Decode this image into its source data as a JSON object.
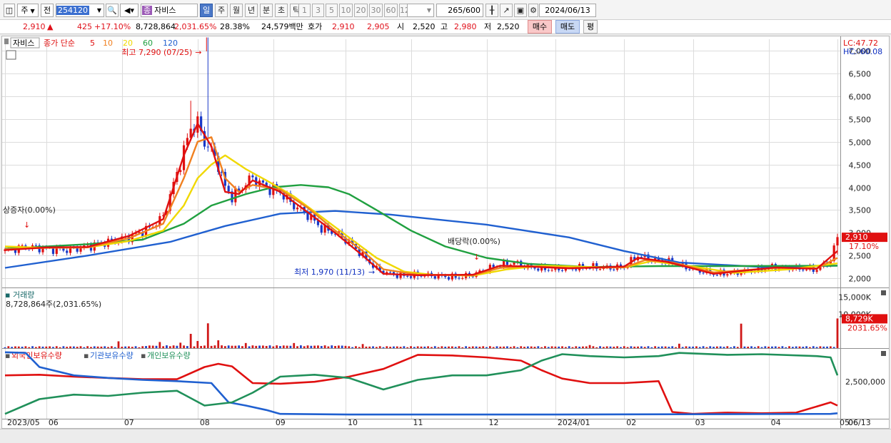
{
  "toolbar": {
    "market_select": "주",
    "prev_label": "전",
    "code": "254120",
    "name_badge": "종",
    "stock_name": "자비스",
    "period_buttons": [
      "일",
      "주",
      "월",
      "년",
      "분",
      "초",
      "틱"
    ],
    "active_period": "일",
    "interval_buttons": [
      "1",
      "3",
      "5",
      "10",
      "20",
      "30",
      "60",
      "120"
    ],
    "count": "265",
    "count_total": "/600",
    "date": "2024/06/13"
  },
  "quote": {
    "price": "2,910",
    "arrow": "▲",
    "change": "425",
    "change_pct": "+17.10%",
    "volume": "8,728,864",
    "volume_ratio": "2,031.65%",
    "turnover": "28.38%",
    "amount": "24,579백만",
    "hoga_label": "호가",
    "ask": "2,910",
    "bid": "2,905",
    "open_label": "시",
    "open": "2,520",
    "high_label": "고",
    "high": "2,980",
    "low_label": "저",
    "low": "2,520",
    "buy_button": "매수",
    "sell_button": "매도",
    "eval_button": "평"
  },
  "price_panel": {
    "legend_name": "자비스",
    "legend_ma_label": "종가 단순",
    "ma_periods": [
      "5",
      "10",
      "20",
      "60",
      "120"
    ],
    "ma_colors": [
      "#e01010",
      "#f08020",
      "#f0d800",
      "#20a040",
      "#2060d0"
    ],
    "lc": "LC:47.72",
    "hc": "HC:-60.08",
    "last_price": "2,910",
    "last_pct": "17.10%",
    "annotations": {
      "high": "최고 7,290 (07/25)",
      "low": "최저 1,970 (11/13)",
      "rights": "상증자(0.00%)",
      "dividend": "배당락(0.00%)"
    }
  },
  "volume_panel": {
    "title": "거래량",
    "value": "8,728,864주(2,031.65%)",
    "last_value": "8,729K",
    "last_pct": "2031.65%"
  },
  "holding_panel": {
    "series_labels": [
      "외국인보유수량",
      "기관보유수량",
      "개인보유수량"
    ],
    "series_colors": [
      "#e01010",
      "#2060d0",
      "#20905a"
    ]
  },
  "chart_data": [
    {
      "type": "candlestick",
      "title": "자비스",
      "x": [
        "2023/05",
        "06",
        "07",
        "08",
        "09",
        "10",
        "11",
        "12",
        "2024/01",
        "02",
        "03",
        "04",
        "05",
        "06"
      ],
      "y_ticks": [
        2000,
        2500,
        3000,
        3500,
        4000,
        4500,
        5000,
        5500,
        6000,
        6500,
        7000
      ],
      "ylim": [
        1800,
        7250
      ],
      "close_path": [
        [
          0,
          2600
        ],
        [
          6,
          2700
        ],
        [
          12,
          2650
        ],
        [
          18,
          2620
        ],
        [
          24,
          2700
        ],
        [
          30,
          2800
        ],
        [
          36,
          2900
        ],
        [
          42,
          3100
        ],
        [
          46,
          3350
        ],
        [
          50,
          4300
        ],
        [
          54,
          5300
        ],
        [
          56,
          5400
        ],
        [
          58,
          5000
        ],
        [
          60,
          4800
        ],
        [
          62,
          4500
        ],
        [
          64,
          4000
        ],
        [
          66,
          3800
        ],
        [
          68,
          3900
        ],
        [
          70,
          4100
        ],
        [
          72,
          4200
        ],
        [
          76,
          4000
        ],
        [
          80,
          3900
        ],
        [
          84,
          3600
        ],
        [
          88,
          3400
        ],
        [
          92,
          3100
        ],
        [
          96,
          3000
        ],
        [
          100,
          2800
        ],
        [
          104,
          2500
        ],
        [
          108,
          2200
        ],
        [
          112,
          2100
        ],
        [
          116,
          2050
        ],
        [
          120,
          2080
        ],
        [
          126,
          2050
        ],
        [
          132,
          2020
        ],
        [
          136,
          2080
        ],
        [
          140,
          2200
        ],
        [
          144,
          2300
        ],
        [
          148,
          2350
        ],
        [
          152,
          2250
        ],
        [
          158,
          2200
        ],
        [
          164,
          2220
        ],
        [
          170,
          2250
        ],
        [
          176,
          2230
        ],
        [
          180,
          2250
        ],
        [
          184,
          2500
        ],
        [
          188,
          2400
        ],
        [
          194,
          2350
        ],
        [
          200,
          2200
        ],
        [
          206,
          2100
        ],
        [
          212,
          2120
        ],
        [
          218,
          2180
        ],
        [
          224,
          2250
        ],
        [
          230,
          2220
        ],
        [
          236,
          2200
        ],
        [
          240,
          2400
        ],
        [
          242,
          2910
        ]
      ],
      "ma5_path": [
        [
          0,
          2620
        ],
        [
          12,
          2680
        ],
        [
          24,
          2690
        ],
        [
          36,
          2930
        ],
        [
          46,
          3300
        ],
        [
          52,
          4700
        ],
        [
          56,
          5400
        ],
        [
          60,
          4900
        ],
        [
          64,
          3900
        ],
        [
          68,
          3850
        ],
        [
          72,
          4150
        ],
        [
          80,
          3900
        ],
        [
          88,
          3450
        ],
        [
          96,
          3000
        ],
        [
          104,
          2500
        ],
        [
          110,
          2100
        ],
        [
          120,
          2070
        ],
        [
          136,
          2080
        ],
        [
          144,
          2280
        ],
        [
          152,
          2260
        ],
        [
          164,
          2220
        ],
        [
          180,
          2260
        ],
        [
          184,
          2450
        ],
        [
          192,
          2370
        ],
        [
          206,
          2100
        ],
        [
          224,
          2240
        ],
        [
          236,
          2210
        ],
        [
          242,
          2600
        ]
      ],
      "ma10_path": [
        [
          0,
          2640
        ],
        [
          12,
          2670
        ],
        [
          24,
          2680
        ],
        [
          36,
          2880
        ],
        [
          46,
          3200
        ],
        [
          52,
          4200
        ],
        [
          56,
          5000
        ],
        [
          60,
          5100
        ],
        [
          64,
          4200
        ],
        [
          68,
          3900
        ],
        [
          72,
          4050
        ],
        [
          80,
          3950
        ],
        [
          88,
          3550
        ],
        [
          96,
          3050
        ],
        [
          104,
          2600
        ],
        [
          110,
          2200
        ],
        [
          120,
          2080
        ],
        [
          136,
          2070
        ],
        [
          144,
          2230
        ],
        [
          152,
          2270
        ],
        [
          164,
          2230
        ],
        [
          180,
          2240
        ],
        [
          186,
          2400
        ],
        [
          194,
          2350
        ],
        [
          206,
          2130
        ],
        [
          224,
          2230
        ],
        [
          236,
          2220
        ],
        [
          242,
          2450
        ]
      ],
      "ma20_path": [
        [
          0,
          2700
        ],
        [
          12,
          2670
        ],
        [
          24,
          2680
        ],
        [
          36,
          2820
        ],
        [
          46,
          3050
        ],
        [
          52,
          3600
        ],
        [
          56,
          4200
        ],
        [
          60,
          4500
        ],
        [
          64,
          4700
        ],
        [
          70,
          4400
        ],
        [
          76,
          4150
        ],
        [
          84,
          3800
        ],
        [
          92,
          3350
        ],
        [
          100,
          2900
        ],
        [
          108,
          2450
        ],
        [
          116,
          2150
        ],
        [
          124,
          2080
        ],
        [
          136,
          2060
        ],
        [
          146,
          2200
        ],
        [
          156,
          2280
        ],
        [
          170,
          2250
        ],
        [
          180,
          2240
        ],
        [
          188,
          2380
        ],
        [
          200,
          2260
        ],
        [
          212,
          2120
        ],
        [
          228,
          2200
        ],
        [
          242,
          2330
        ]
      ],
      "ma60_path": [
        [
          0,
          2650
        ],
        [
          24,
          2750
        ],
        [
          40,
          2850
        ],
        [
          52,
          3200
        ],
        [
          60,
          3600
        ],
        [
          70,
          3850
        ],
        [
          78,
          4000
        ],
        [
          86,
          4050
        ],
        [
          94,
          4000
        ],
        [
          100,
          3850
        ],
        [
          108,
          3500
        ],
        [
          118,
          3050
        ],
        [
          128,
          2700
        ],
        [
          140,
          2450
        ],
        [
          152,
          2320
        ],
        [
          170,
          2250
        ],
        [
          190,
          2270
        ],
        [
          210,
          2270
        ],
        [
          242,
          2280
        ]
      ],
      "ma120_path": [
        [
          0,
          2230
        ],
        [
          24,
          2500
        ],
        [
          48,
          2800
        ],
        [
          64,
          3150
        ],
        [
          80,
          3420
        ],
        [
          96,
          3480
        ],
        [
          112,
          3400
        ],
        [
          140,
          3180
        ],
        [
          164,
          2900
        ],
        [
          180,
          2600
        ],
        [
          196,
          2350
        ],
        [
          220,
          2250
        ],
        [
          242,
          2280
        ]
      ]
    },
    {
      "type": "bar",
      "title": "거래량",
      "y_ticks": [
        "10,000K",
        "15,000K"
      ],
      "spikes": [
        [
          33,
          2000
        ],
        [
          45,
          1800
        ],
        [
          51,
          1600
        ],
        [
          54,
          4200
        ],
        [
          56,
          2100
        ],
        [
          59,
          7300
        ],
        [
          62,
          2300
        ],
        [
          70,
          1500
        ],
        [
          84,
          1500
        ],
        [
          104,
          1200
        ],
        [
          170,
          900
        ],
        [
          196,
          1300
        ],
        [
          214,
          7200
        ],
        [
          242,
          8729
        ]
      ]
    },
    {
      "type": "line",
      "title": "외국인보유수량 · 기관보유수량 · 개인보유수량",
      "y_ticks": [
        "2,500,000"
      ],
      "series": [
        {
          "name": "외국인보유수량",
          "path": [
            [
              0,
              0.62
            ],
            [
              10,
              0.63
            ],
            [
              20,
              0.6
            ],
            [
              30,
              0.58
            ],
            [
              40,
              0.56
            ],
            [
              50,
              0.56
            ],
            [
              58,
              0.75
            ],
            [
              62,
              0.8
            ],
            [
              66,
              0.76
            ],
            [
              72,
              0.5
            ],
            [
              80,
              0.49
            ],
            [
              90,
              0.52
            ],
            [
              100,
              0.6
            ],
            [
              110,
              0.72
            ],
            [
              120,
              0.94
            ],
            [
              130,
              0.93
            ],
            [
              140,
              0.9
            ],
            [
              150,
              0.85
            ],
            [
              156,
              0.7
            ],
            [
              162,
              0.57
            ],
            [
              170,
              0.5
            ],
            [
              180,
              0.5
            ],
            [
              190,
              0.53
            ],
            [
              194,
              0.05
            ],
            [
              200,
              0.02
            ],
            [
              210,
              0.04
            ],
            [
              220,
              0.03
            ],
            [
              230,
              0.04
            ],
            [
              240,
              0.2
            ],
            [
              242,
              0.15
            ]
          ]
        },
        {
          "name": "기관보유수량",
          "path": [
            [
              0,
              0.98
            ],
            [
              6,
              0.97
            ],
            [
              10,
              0.75
            ],
            [
              20,
              0.62
            ],
            [
              30,
              0.58
            ],
            [
              40,
              0.55
            ],
            [
              50,
              0.53
            ],
            [
              60,
              0.5
            ],
            [
              65,
              0.2
            ],
            [
              70,
              0.15
            ],
            [
              76,
              0.08
            ],
            [
              80,
              0.02
            ],
            [
              100,
              0.01
            ],
            [
              160,
              0.01
            ],
            [
              240,
              0.02
            ],
            [
              242,
              0.03
            ]
          ]
        },
        {
          "name": "개인보유수량",
          "path": [
            [
              0,
              0.02
            ],
            [
              10,
              0.25
            ],
            [
              20,
              0.32
            ],
            [
              30,
              0.3
            ],
            [
              40,
              0.35
            ],
            [
              50,
              0.38
            ],
            [
              58,
              0.15
            ],
            [
              66,
              0.2
            ],
            [
              72,
              0.35
            ],
            [
              80,
              0.6
            ],
            [
              90,
              0.63
            ],
            [
              100,
              0.58
            ],
            [
              110,
              0.4
            ],
            [
              120,
              0.55
            ],
            [
              130,
              0.62
            ],
            [
              140,
              0.62
            ],
            [
              150,
              0.7
            ],
            [
              156,
              0.85
            ],
            [
              162,
              0.95
            ],
            [
              170,
              0.92
            ],
            [
              180,
              0.9
            ],
            [
              190,
              0.92
            ],
            [
              196,
              0.97
            ],
            [
              210,
              0.94
            ],
            [
              220,
              0.95
            ],
            [
              236,
              0.92
            ],
            [
              240,
              0.9
            ],
            [
              242,
              0.62
            ]
          ]
        }
      ]
    }
  ]
}
